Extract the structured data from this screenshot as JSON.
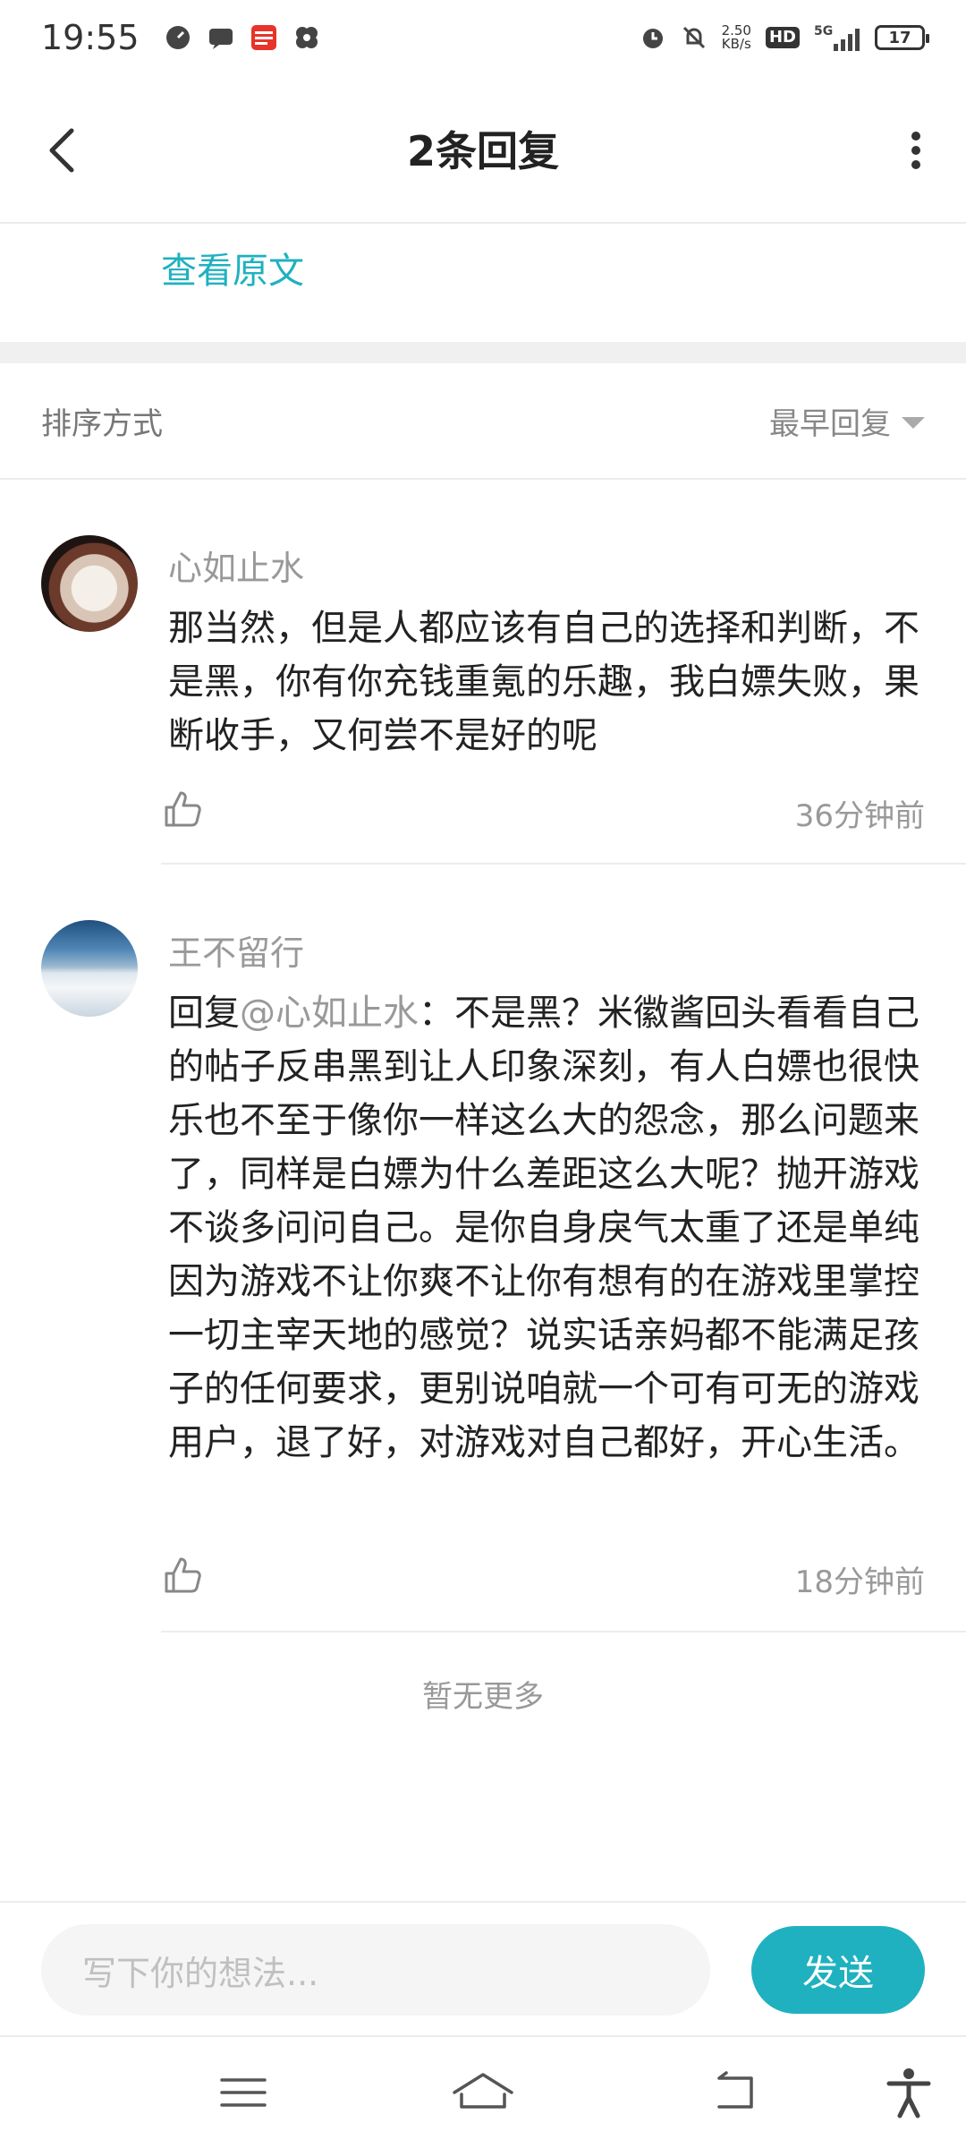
{
  "status_bar": {
    "time": "19:55",
    "net_speed_value": "2.50",
    "net_speed_unit": "KB/s",
    "hd_label": "HD",
    "network_label": "5G",
    "battery": "17"
  },
  "header": {
    "title": "2条回复"
  },
  "original": {
    "view_link": "查看原文"
  },
  "sort": {
    "label": "排序方式",
    "selected": "最早回复"
  },
  "comments": [
    {
      "user": "心如止水",
      "text": "那当然，但是人都应该有自己的选择和判断，不是黑，你有你充钱重氪的乐趣，我白嫖失败，果断收手，又何尝不是好的呢",
      "time": "36分钟前"
    },
    {
      "user": "王不留行",
      "reply_prefix": "回复",
      "mention": "@心如止水",
      "text": "：不是黑？米徽酱回头看看自己的帖子反串黑到让人印象深刻，有人白嫖也很快乐也不至于像你一样这么大的怨念，那么问题来了，同样是白嫖为什么差距这么大呢？抛开游戏不谈多问问自己。是你自身戾气太重了还是单纯因为游戏不让你爽不让你有想有的在游戏里掌控一切主宰天地的感觉？说实话亲妈都不能满足孩子的任何要求，更别说咱就一个可有可无的游戏用户，退了好，对游戏对自己都好，开心生活。",
      "time": "18分钟前"
    }
  ],
  "footer": {
    "no_more": "暂无更多"
  },
  "input": {
    "placeholder": "写下你的想法...",
    "send_label": "发送"
  },
  "colors": {
    "accent": "#1fb1bf",
    "divider": "#ececec",
    "muted_text": "#999999"
  }
}
